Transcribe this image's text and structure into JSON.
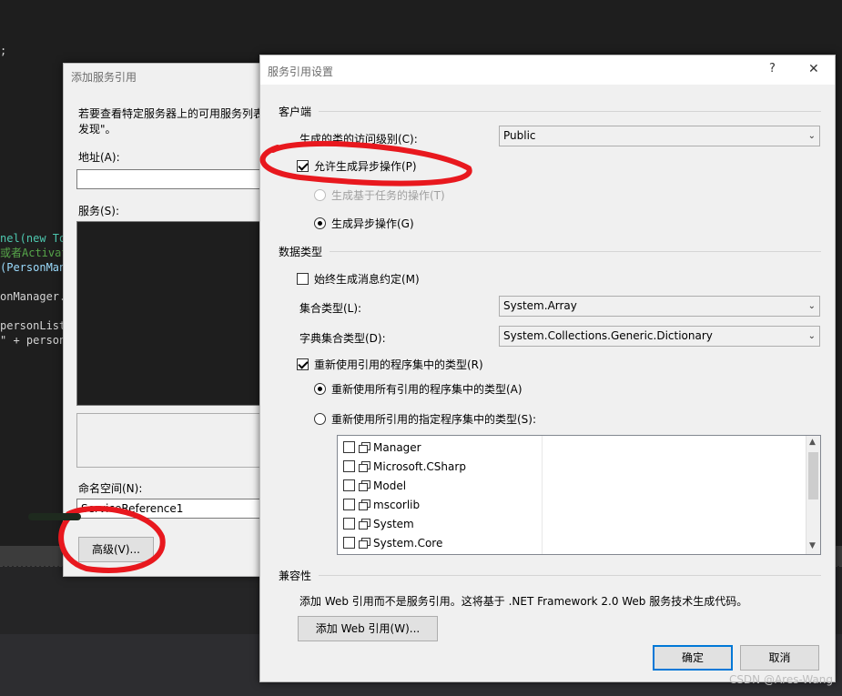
{
  "code_lines": [
    {
      "text": ";",
      "color": "#d4d4d4"
    },
    {
      "text": "nel(new To",
      "color": "#4ec9b0"
    },
    {
      "text": "或者Activat",
      "color": "#57a64a"
    },
    {
      "text": "(PersonMan",
      "color": "#9cdcfe"
    },
    {
      "text": "onManager.",
      "color": "#d4d4d4"
    },
    {
      "text": "personList",
      "color": "#d4d4d4"
    },
    {
      "text": "\" + person",
      "color": "#d4d4d4"
    }
  ],
  "add_service_dialog": {
    "title": "添加服务引用",
    "description_line1": "若要查看特定服务器上的可用服务列表",
    "description_line2": "发现\"。",
    "address_label": "地址(A):",
    "address_value": "",
    "services_label": "服务(S):",
    "namespace_label": "命名空间(N):",
    "namespace_value": "ServiceReference1",
    "advanced_button": "高级(V)..."
  },
  "settings_dialog": {
    "title": "服务引用设置",
    "help_glyph": "?",
    "close_glyph": "✕",
    "client_section": "客户端",
    "access_level_label": "生成的类的访问级别(C):",
    "access_level_value": "Public",
    "allow_async_label": "允许生成异步操作(P)",
    "allow_async_checked": true,
    "task_based_label": "生成基于任务的操作(T)",
    "async_ops_label": "生成异步操作(G)",
    "data_type_section": "数据类型",
    "always_message_contracts_label": "始终生成消息约定(M)",
    "always_message_contracts_checked": false,
    "collection_type_label": "集合类型(L):",
    "collection_type_value": "System.Array",
    "dictionary_type_label": "字典集合类型(D):",
    "dictionary_type_value": "System.Collections.Generic.Dictionary",
    "reuse_types_label": "重新使用引用的程序集中的类型(R)",
    "reuse_types_checked": true,
    "reuse_all_label": "重新使用所有引用的程序集中的类型(A)",
    "reuse_specified_label": "重新使用所引用的指定程序集中的类型(S):",
    "assemblies": [
      "Manager",
      "Microsoft.CSharp",
      "Model",
      "mscorlib",
      "System",
      "System.Core"
    ],
    "compat_section": "兼容性",
    "compat_description": "添加 Web 引用而不是服务引用。这将基于 .NET Framework 2.0 Web 服务技术生成代码。",
    "add_web_ref_button": "添加 Web 引用(W)...",
    "ok_button": "确定",
    "cancel_button": "取消"
  },
  "watermark": "CSDN @Ares-Wang",
  "annotation_color": "#e8181e"
}
